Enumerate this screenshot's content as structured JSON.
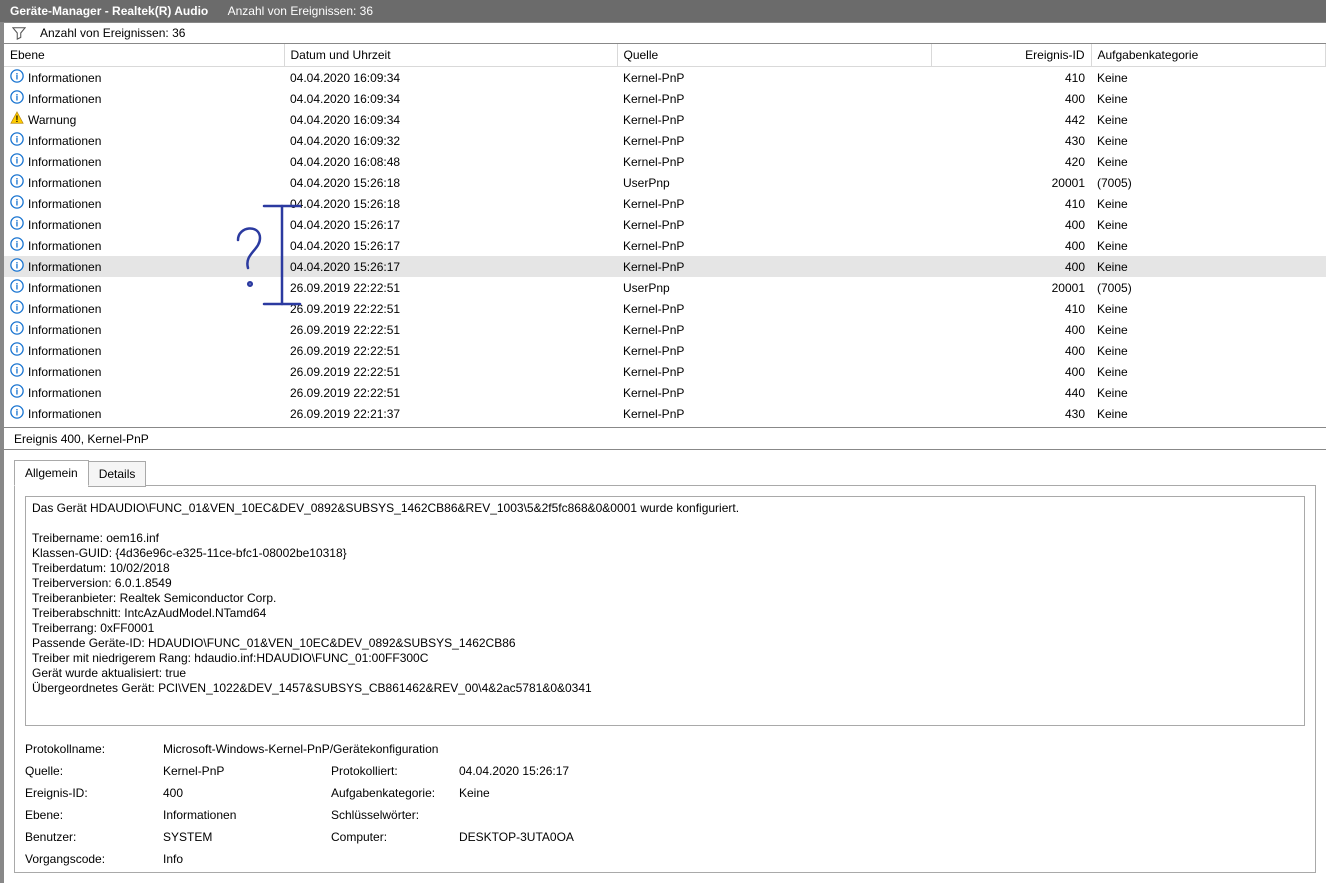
{
  "titlebar": {
    "title": "Geräte-Manager - Realtek(R) Audio",
    "count_label": "Anzahl von Ereignissen: 36"
  },
  "filterbar": {
    "count_label": "Anzahl von Ereignissen: 36"
  },
  "grid": {
    "columns": {
      "level": "Ebene",
      "date": "Datum und Uhrzeit",
      "source": "Quelle",
      "eventid": "Ereignis-ID",
      "category": "Aufgabenkategorie"
    },
    "rows": [
      {
        "icon": "info",
        "level": "Informationen",
        "date": "04.04.2020 16:09:34",
        "source": "Kernel-PnP",
        "eventid": "410",
        "category": "Keine",
        "selected": false
      },
      {
        "icon": "info",
        "level": "Informationen",
        "date": "04.04.2020 16:09:34",
        "source": "Kernel-PnP",
        "eventid": "400",
        "category": "Keine",
        "selected": false
      },
      {
        "icon": "warn",
        "level": "Warnung",
        "date": "04.04.2020 16:09:34",
        "source": "Kernel-PnP",
        "eventid": "442",
        "category": "Keine",
        "selected": false
      },
      {
        "icon": "info",
        "level": "Informationen",
        "date": "04.04.2020 16:09:32",
        "source": "Kernel-PnP",
        "eventid": "430",
        "category": "Keine",
        "selected": false
      },
      {
        "icon": "info",
        "level": "Informationen",
        "date": "04.04.2020 16:08:48",
        "source": "Kernel-PnP",
        "eventid": "420",
        "category": "Keine",
        "selected": false
      },
      {
        "icon": "info",
        "level": "Informationen",
        "date": "04.04.2020 15:26:18",
        "source": "UserPnp",
        "eventid": "20001",
        "category": "(7005)",
        "selected": false
      },
      {
        "icon": "info",
        "level": "Informationen",
        "date": "04.04.2020 15:26:18",
        "source": "Kernel-PnP",
        "eventid": "410",
        "category": "Keine",
        "selected": false
      },
      {
        "icon": "info",
        "level": "Informationen",
        "date": "04.04.2020 15:26:17",
        "source": "Kernel-PnP",
        "eventid": "400",
        "category": "Keine",
        "selected": false
      },
      {
        "icon": "info",
        "level": "Informationen",
        "date": "04.04.2020 15:26:17",
        "source": "Kernel-PnP",
        "eventid": "400",
        "category": "Keine",
        "selected": false
      },
      {
        "icon": "info",
        "level": "Informationen",
        "date": "04.04.2020 15:26:17",
        "source": "Kernel-PnP",
        "eventid": "400",
        "category": "Keine",
        "selected": true
      },
      {
        "icon": "info",
        "level": "Informationen",
        "date": "26.09.2019 22:22:51",
        "source": "UserPnp",
        "eventid": "20001",
        "category": "(7005)",
        "selected": false
      },
      {
        "icon": "info",
        "level": "Informationen",
        "date": "26.09.2019 22:22:51",
        "source": "Kernel-PnP",
        "eventid": "410",
        "category": "Keine",
        "selected": false
      },
      {
        "icon": "info",
        "level": "Informationen",
        "date": "26.09.2019 22:22:51",
        "source": "Kernel-PnP",
        "eventid": "400",
        "category": "Keine",
        "selected": false
      },
      {
        "icon": "info",
        "level": "Informationen",
        "date": "26.09.2019 22:22:51",
        "source": "Kernel-PnP",
        "eventid": "400",
        "category": "Keine",
        "selected": false
      },
      {
        "icon": "info",
        "level": "Informationen",
        "date": "26.09.2019 22:22:51",
        "source": "Kernel-PnP",
        "eventid": "400",
        "category": "Keine",
        "selected": false
      },
      {
        "icon": "info",
        "level": "Informationen",
        "date": "26.09.2019 22:22:51",
        "source": "Kernel-PnP",
        "eventid": "440",
        "category": "Keine",
        "selected": false
      },
      {
        "icon": "info",
        "level": "Informationen",
        "date": "26.09.2019 22:21:37",
        "source": "Kernel-PnP",
        "eventid": "430",
        "category": "Keine",
        "selected": false
      }
    ]
  },
  "detail": {
    "title": "Ereignis 400, Kernel-PnP",
    "tabs": {
      "general": "Allgemein",
      "details": "Details"
    },
    "description": "Das Gerät HDAUDIO\\FUNC_01&VEN_10EC&DEV_0892&SUBSYS_1462CB86&REV_1003\\5&2f5fc868&0&0001 wurde konfiguriert.\n\nTreibername: oem16.inf\nKlassen-GUID: {4d36e96c-e325-11ce-bfc1-08002be10318}\nTreiberdatum: 10/02/2018\nTreiberversion: 6.0.1.8549\nTreiberanbieter: Realtek Semiconductor Corp.\nTreiberabschnitt: IntcAzAudModel.NTamd64\nTreiberrang: 0xFF0001\nPassende Geräte-ID: HDAUDIO\\FUNC_01&VEN_10EC&DEV_0892&SUBSYS_1462CB86\nTreiber mit niedrigerem Rang: hdaudio.inf:HDAUDIO\\FUNC_01:00FF300C\nGerät wurde aktualisiert: true\nÜbergeordnetes Gerät: PCI\\VEN_1022&DEV_1457&SUBSYS_CB861462&REV_00\\4&2ac5781&0&0341",
    "meta": {
      "logname_lbl": "Protokollname:",
      "logname_val": "Microsoft-Windows-Kernel-PnP/Gerätekonfiguration",
      "source_lbl": "Quelle:",
      "source_val": "Kernel-PnP",
      "logged_lbl": "Protokolliert:",
      "logged_val": "04.04.2020 15:26:17",
      "eventid_lbl": "Ereignis-ID:",
      "eventid_val": "400",
      "category_lbl": "Aufgabenkategorie:",
      "category_val": "Keine",
      "level_lbl": "Ebene:",
      "level_val": "Informationen",
      "keywords_lbl": "Schlüsselwörter:",
      "keywords_val": "",
      "user_lbl": "Benutzer:",
      "user_val": "SYSTEM",
      "computer_lbl": "Computer:",
      "computer_val": "DESKTOP-3UTA0OA",
      "opcode_lbl": "Vorgangscode:",
      "opcode_val": "Info"
    }
  }
}
